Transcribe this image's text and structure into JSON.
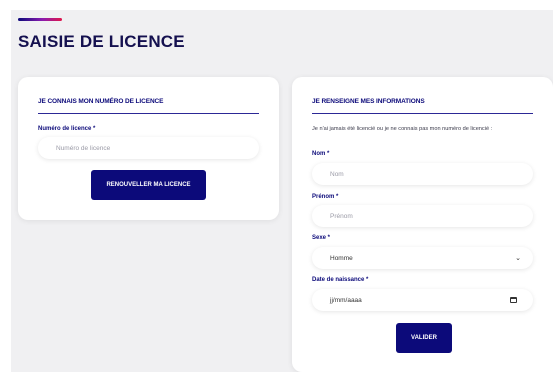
{
  "page": {
    "title": "SAISIE DE LICENCE",
    "accent_colors": [
      "#0c0a7a",
      "#8a1bb0",
      "#e0164a"
    ]
  },
  "left_card": {
    "heading": "JE CONNAIS MON NUMÉRO DE LICENCE",
    "license_label": "Numéro de licence *",
    "license_placeholder": "Numéro de licence",
    "renew_button": "RENOUVELLER MA LICENCE"
  },
  "right_card": {
    "heading": "JE RENSEIGNE MES INFORMATIONS",
    "help_text": "Je n'ai jamais été licencié ou je ne connais pas mon numéro de licencié :",
    "nom_label": "Nom *",
    "nom_placeholder": "Nom",
    "prenom_label": "Prénom *",
    "prenom_placeholder": "Prénom",
    "sexe_label": "Sexe *",
    "sexe_value": "Homme",
    "dob_label": "Date de naissance *",
    "dob_placeholder": "jj/mm/aaaa",
    "submit_button": "VALIDER"
  },
  "colors": {
    "primary": "#0c0a7a",
    "background": "#f0f0f2",
    "card": "#ffffff"
  },
  "icons": {
    "select": "chevron-down-icon",
    "date": "calendar-icon"
  }
}
